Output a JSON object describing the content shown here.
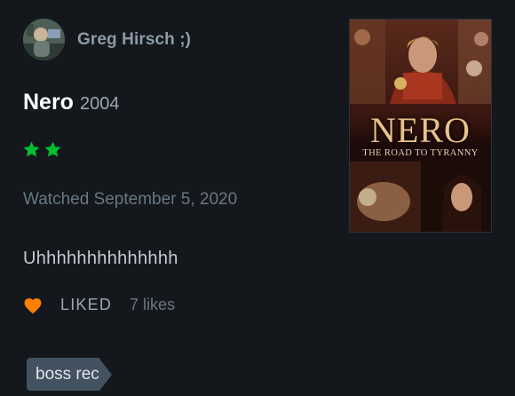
{
  "user": {
    "name": "Greg Hirsch ;)",
    "avatar_icon": "user-avatar-photo"
  },
  "film": {
    "title": "Nero",
    "year": "2004",
    "poster": {
      "title": "NERO",
      "subtitle": "THE ROAD TO TYRANNY"
    }
  },
  "rating": {
    "stars": 2,
    "max_stars_shown": 2,
    "color": "#00c030",
    "icon": "star-icon"
  },
  "watched": "Watched September 5, 2020",
  "review": "Uhhhhhhhhhhhhhh",
  "like": {
    "icon": "heart-icon",
    "color": "#ff8000",
    "label": "LIKED",
    "count": "7 likes"
  },
  "tags": [
    {
      "label": "boss rec"
    }
  ],
  "colors": {
    "background": "#14181c",
    "tag_background": "#435260"
  }
}
